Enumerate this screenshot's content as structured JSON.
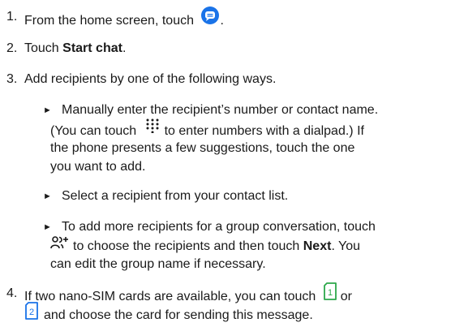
{
  "steps": [
    {
      "number": "1.",
      "pre": "From the home screen, touch",
      "post": ".",
      "icon": "messages-app-icon"
    },
    {
      "number": "2.",
      "pre": "Touch ",
      "bold": "Start chat",
      "post": "."
    },
    {
      "number": "3.",
      "text": "Add recipients by one of the following ways."
    },
    {
      "number": "4.",
      "line1_pre": "If two nano-SIM cards are available, you can touch",
      "line1_post": "or",
      "line2_post": "and choose the card for sending this message.",
      "icons": [
        "sim-card-1-icon",
        "sim-card-2-icon"
      ]
    }
  ],
  "bullets": [
    {
      "line1": "Manually enter the recipient’s number or contact name.",
      "line2_pre": "(You can touch",
      "line2_post": "to enter numbers with a dialpad.) If",
      "line3": "the phone presents a few suggestions, touch the one",
      "line4": "you want to add.",
      "icon": "dialpad-icon"
    },
    {
      "line1": "Select a recipient from your contact list."
    },
    {
      "line1": "To add more recipients for a group conversation, touch",
      "line2_post": "to choose the recipients and then touch ",
      "line2_bold": "Next",
      "line2_end": ". You",
      "line3": "can edit the group name if necessary.",
      "icon": "add-people-icon"
    }
  ],
  "bullet_glyph": "►",
  "colors": {
    "text": "#1a1a1a",
    "accent": "#1a73e8"
  }
}
